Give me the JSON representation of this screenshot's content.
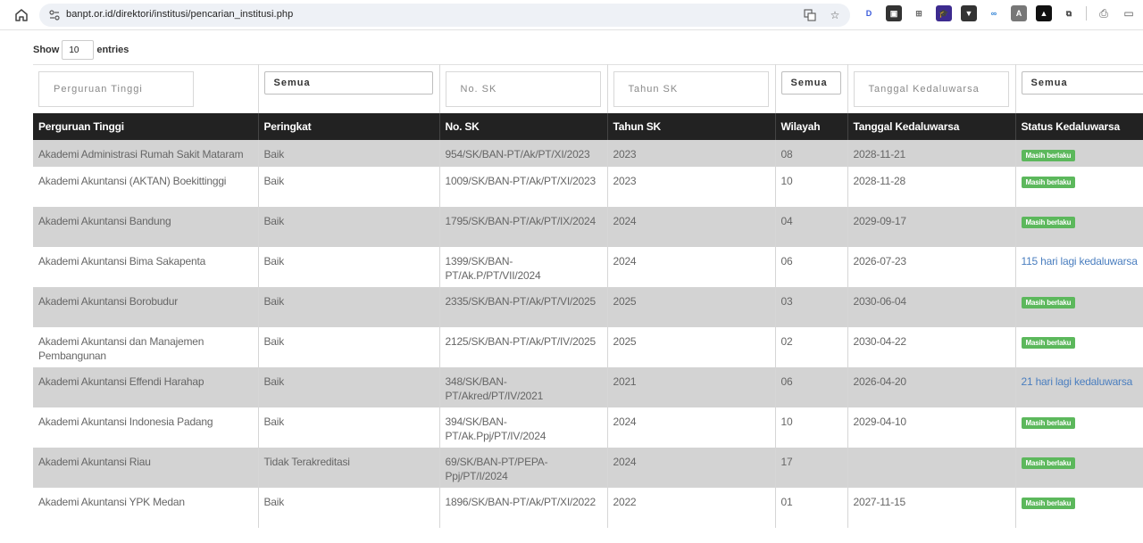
{
  "browser": {
    "url": "banpt.or.id/direktori/institusi/pencarian_institusi.php",
    "extensions": [
      {
        "name": "d-ext-icon",
        "glyph": "D",
        "color": "#3b5bdb"
      },
      {
        "name": "ext-107-icon",
        "glyph": "▣",
        "color": "#333333",
        "badge": "1:07"
      },
      {
        "name": "ext-frame-icon",
        "glyph": "⊞",
        "color": "#666666"
      },
      {
        "name": "ext-hat-icon",
        "glyph": "🎓",
        "color": "#3d2b8f",
        "badge": "21"
      },
      {
        "name": "ext-save-icon",
        "glyph": "▼",
        "color": "#333333"
      },
      {
        "name": "ext-glasses-icon",
        "glyph": "∞",
        "color": "#2a7fd4"
      },
      {
        "name": "ext-a-icon",
        "glyph": "A",
        "color": "#777777"
      },
      {
        "name": "ext-rel-icon",
        "glyph": "▲",
        "color": "#111111",
        "badge": "rel+"
      },
      {
        "name": "extensions-puzzle-icon",
        "glyph": "⧉",
        "color": "#444444"
      }
    ]
  },
  "length_menu": {
    "show_label": "Show",
    "value": "10",
    "entries_label": "entries"
  },
  "filters": {
    "perguruan_tinggi": "Perguruan Tinggi",
    "peringkat": "Semua",
    "no_sk": "No. SK",
    "tahun_sk": "Tahun SK",
    "wilayah": "Semua",
    "tanggal_kedaluwarsa": "Tanggal Kedaluwarsa",
    "status_kedaluwarsa": "Semua"
  },
  "columns": {
    "perguruan_tinggi": "Perguruan Tinggi",
    "peringkat": "Peringkat",
    "no_sk": "No. SK",
    "tahun_sk": "Tahun SK",
    "wilayah": "Wilayah",
    "tanggal_kedaluwarsa": "Tanggal Kedaluwarsa",
    "status_kedaluwarsa": "Status Kedaluwarsa"
  },
  "rows": [
    {
      "pt": "Akademi Administrasi Rumah Sakit Mataram",
      "peringkat": "Baik",
      "sk": "954/SK/BAN-PT/Ak/PT/XI/2023",
      "tahun": "2023",
      "wilayah": "08",
      "tanggal": "2028-11-21",
      "status": "Masih berlaku",
      "status_type": "badge"
    },
    {
      "pt": "Akademi Akuntansi (AKTAN) Boekittinggi",
      "peringkat": "Baik",
      "sk": "1009/SK/BAN-PT/Ak/PT/XI/2023",
      "tahun": "2023",
      "wilayah": "10",
      "tanggal": "2028-11-28",
      "status": "Masih berlaku",
      "status_type": "badge"
    },
    {
      "pt": "Akademi Akuntansi Bandung",
      "peringkat": "Baik",
      "sk": "1795/SK/BAN-PT/Ak/PT/IX/2024",
      "tahun": "2024",
      "wilayah": "04",
      "tanggal": "2029-09-17",
      "status": "Masih berlaku",
      "status_type": "badge"
    },
    {
      "pt": "Akademi Akuntansi Bima Sakapenta",
      "peringkat": "Baik",
      "sk": "1399/SK/BAN-PT/Ak.P/PT/VII/2024",
      "tahun": "2024",
      "wilayah": "06",
      "tanggal": "2026-07-23",
      "status": "115 hari lagi kedaluwarsa",
      "status_type": "link"
    },
    {
      "pt": "Akademi Akuntansi Borobudur",
      "peringkat": "Baik",
      "sk": "2335/SK/BAN-PT/Ak/PT/VI/2025",
      "tahun": "2025",
      "wilayah": "03",
      "tanggal": "2030-06-04",
      "status": "Masih berlaku",
      "status_type": "badge"
    },
    {
      "pt": "Akademi Akuntansi dan Manajemen Pembangunan",
      "peringkat": "Baik",
      "sk": "2125/SK/BAN-PT/Ak/PT/IV/2025",
      "tahun": "2025",
      "wilayah": "02",
      "tanggal": "2030-04-22",
      "status": "Masih berlaku",
      "status_type": "badge"
    },
    {
      "pt": "Akademi Akuntansi Effendi Harahap",
      "peringkat": "Baik",
      "sk": "348/SK/BAN-PT/Akred/PT/IV/2021",
      "tahun": "2021",
      "wilayah": "06",
      "tanggal": "2026-04-20",
      "status": "21 hari lagi kedaluwarsa",
      "status_type": "link"
    },
    {
      "pt": "Akademi Akuntansi Indonesia Padang",
      "peringkat": "Baik",
      "sk": "394/SK/BAN-PT/Ak.Ppj/PT/IV/2024",
      "tahun": "2024",
      "wilayah": "10",
      "tanggal": "2029-04-10",
      "status": "Masih berlaku",
      "status_type": "badge"
    },
    {
      "pt": "Akademi Akuntansi Riau",
      "peringkat": "Tidak Terakreditasi",
      "sk": "69/SK/BAN-PT/PEPA-Ppj/PT/I/2024",
      "tahun": "2024",
      "wilayah": "17",
      "tanggal": "",
      "status": "Masih berlaku",
      "status_type": "badge"
    },
    {
      "pt": "Akademi Akuntansi YPK Medan",
      "peringkat": "Baik",
      "sk": "1896/SK/BAN-PT/Ak/PT/XI/2022",
      "tahun": "2022",
      "wilayah": "01",
      "tanggal": "2027-11-15",
      "status": "Masih berlaku",
      "status_type": "badge"
    }
  ]
}
